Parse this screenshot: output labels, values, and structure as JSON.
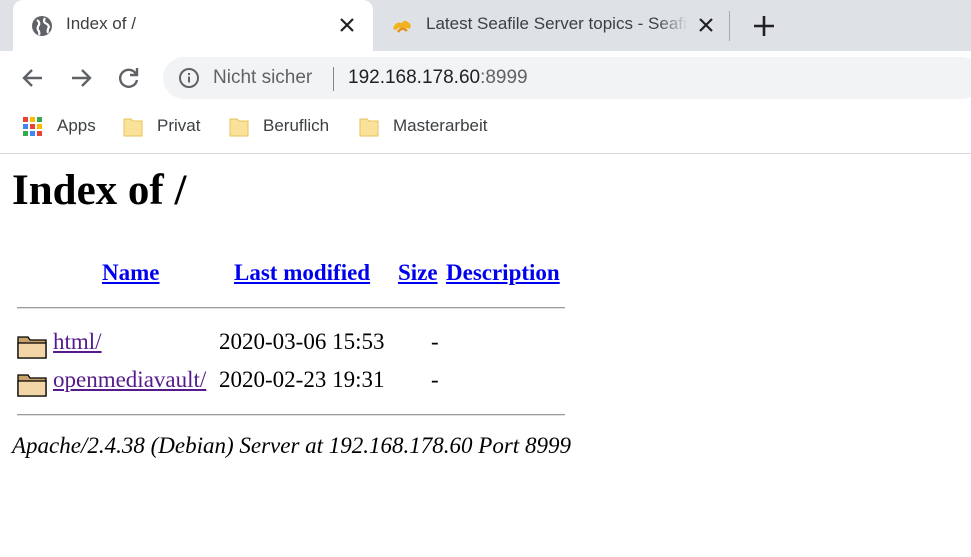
{
  "browser": {
    "tabs": [
      {
        "title": "Index of /",
        "icon": "globe-icon",
        "active": true
      },
      {
        "title": "Latest Seafile Server topics - Seafile",
        "icon": "seafile-icon",
        "active": false
      }
    ],
    "omnibox": {
      "security_label": "Nicht sicher",
      "host": "192.168.178.60",
      "port": ":8999"
    },
    "bookmarks": [
      {
        "label": "Apps",
        "icon": "apps-grid-icon"
      },
      {
        "label": "Privat",
        "icon": "folder-icon"
      },
      {
        "label": "Beruflich",
        "icon": "folder-icon"
      },
      {
        "label": "Masterarbeit",
        "icon": "folder-icon"
      }
    ]
  },
  "page": {
    "heading": "Index of /",
    "columns": {
      "name": "Name",
      "last_modified": "Last modified",
      "size": "Size",
      "description": "Description"
    },
    "entries": [
      {
        "name": "html/",
        "modified": "2020-03-06 15:53",
        "size": "-",
        "icon": "folder-icon"
      },
      {
        "name": "openmediavault/",
        "modified": "2020-02-23 19:31",
        "size": "-",
        "icon": "folder-icon"
      }
    ],
    "server_signature": "Apache/2.4.38 (Debian) Server at 192.168.178.60 Port 8999"
  },
  "colors": {
    "link": "#0000ee",
    "visited_link": "#551a8b",
    "tabstrip_bg": "#dee1e6",
    "omnibox_bg": "#f1f3f4"
  }
}
